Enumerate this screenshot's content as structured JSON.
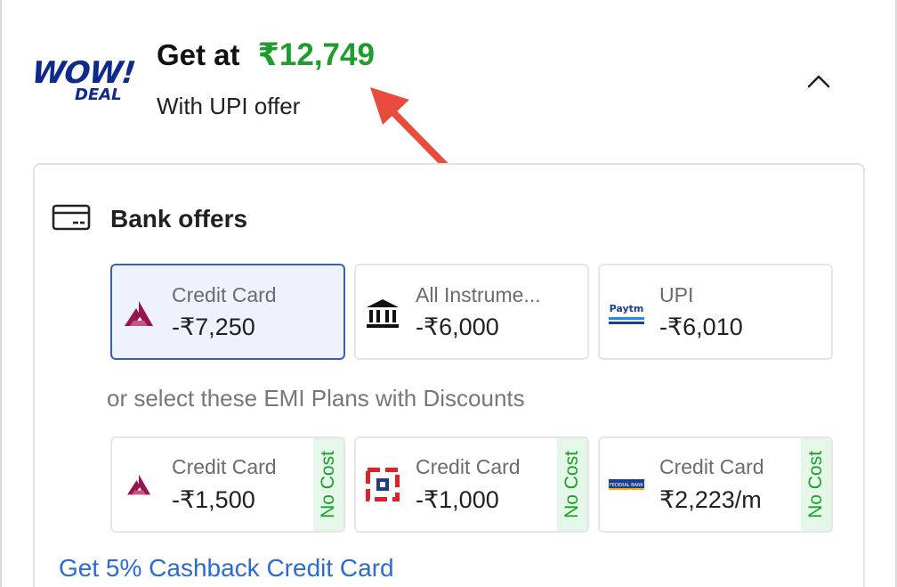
{
  "header": {
    "badge_wow": "WOW!",
    "badge_deal": "DEAL",
    "price_label": "Get at",
    "price_value": "₹12,749",
    "subtitle": "With UPI offer",
    "collapse_icon": "chevron-up-icon"
  },
  "bank_offers": {
    "title": "Bank offers",
    "icon": "credit-card-icon",
    "items": [
      {
        "type": "Credit Card",
        "value": "-₹7,250",
        "logo": "axis-bank-logo",
        "selected": true
      },
      {
        "type": "All Instrume...",
        "value": "-₹6,000",
        "logo": "bank-building-icon",
        "selected": false
      },
      {
        "type": "UPI",
        "value": "-₹6,010",
        "logo": "paytm-logo",
        "logo_text": "Paytm",
        "selected": false
      }
    ]
  },
  "emi": {
    "caption": "or select these EMI Plans with Discounts",
    "items": [
      {
        "type": "Credit Card",
        "value": "-₹1,500",
        "tag": "No Cost",
        "logo": "axis-bank-logo"
      },
      {
        "type": "Credit Card",
        "value": "-₹1,000",
        "tag": "No Cost",
        "logo": "hdfc-bank-logo"
      },
      {
        "type": "Credit Card",
        "value": "₹2,223/m",
        "tag": "No Cost",
        "logo": "federal-bank-logo",
        "logo_text": "FEDERAL BANK"
      }
    ]
  },
  "cashback_link": "Get 5% Cashback Credit Card",
  "colors": {
    "price_green": "#1d9d2b",
    "wow_blue": "#0d2a8c",
    "selected_border": "#3a5fa8",
    "link_blue": "#2a6cd6",
    "axis_red": "#97144d",
    "annotation_arrow": "#e94b3c"
  }
}
